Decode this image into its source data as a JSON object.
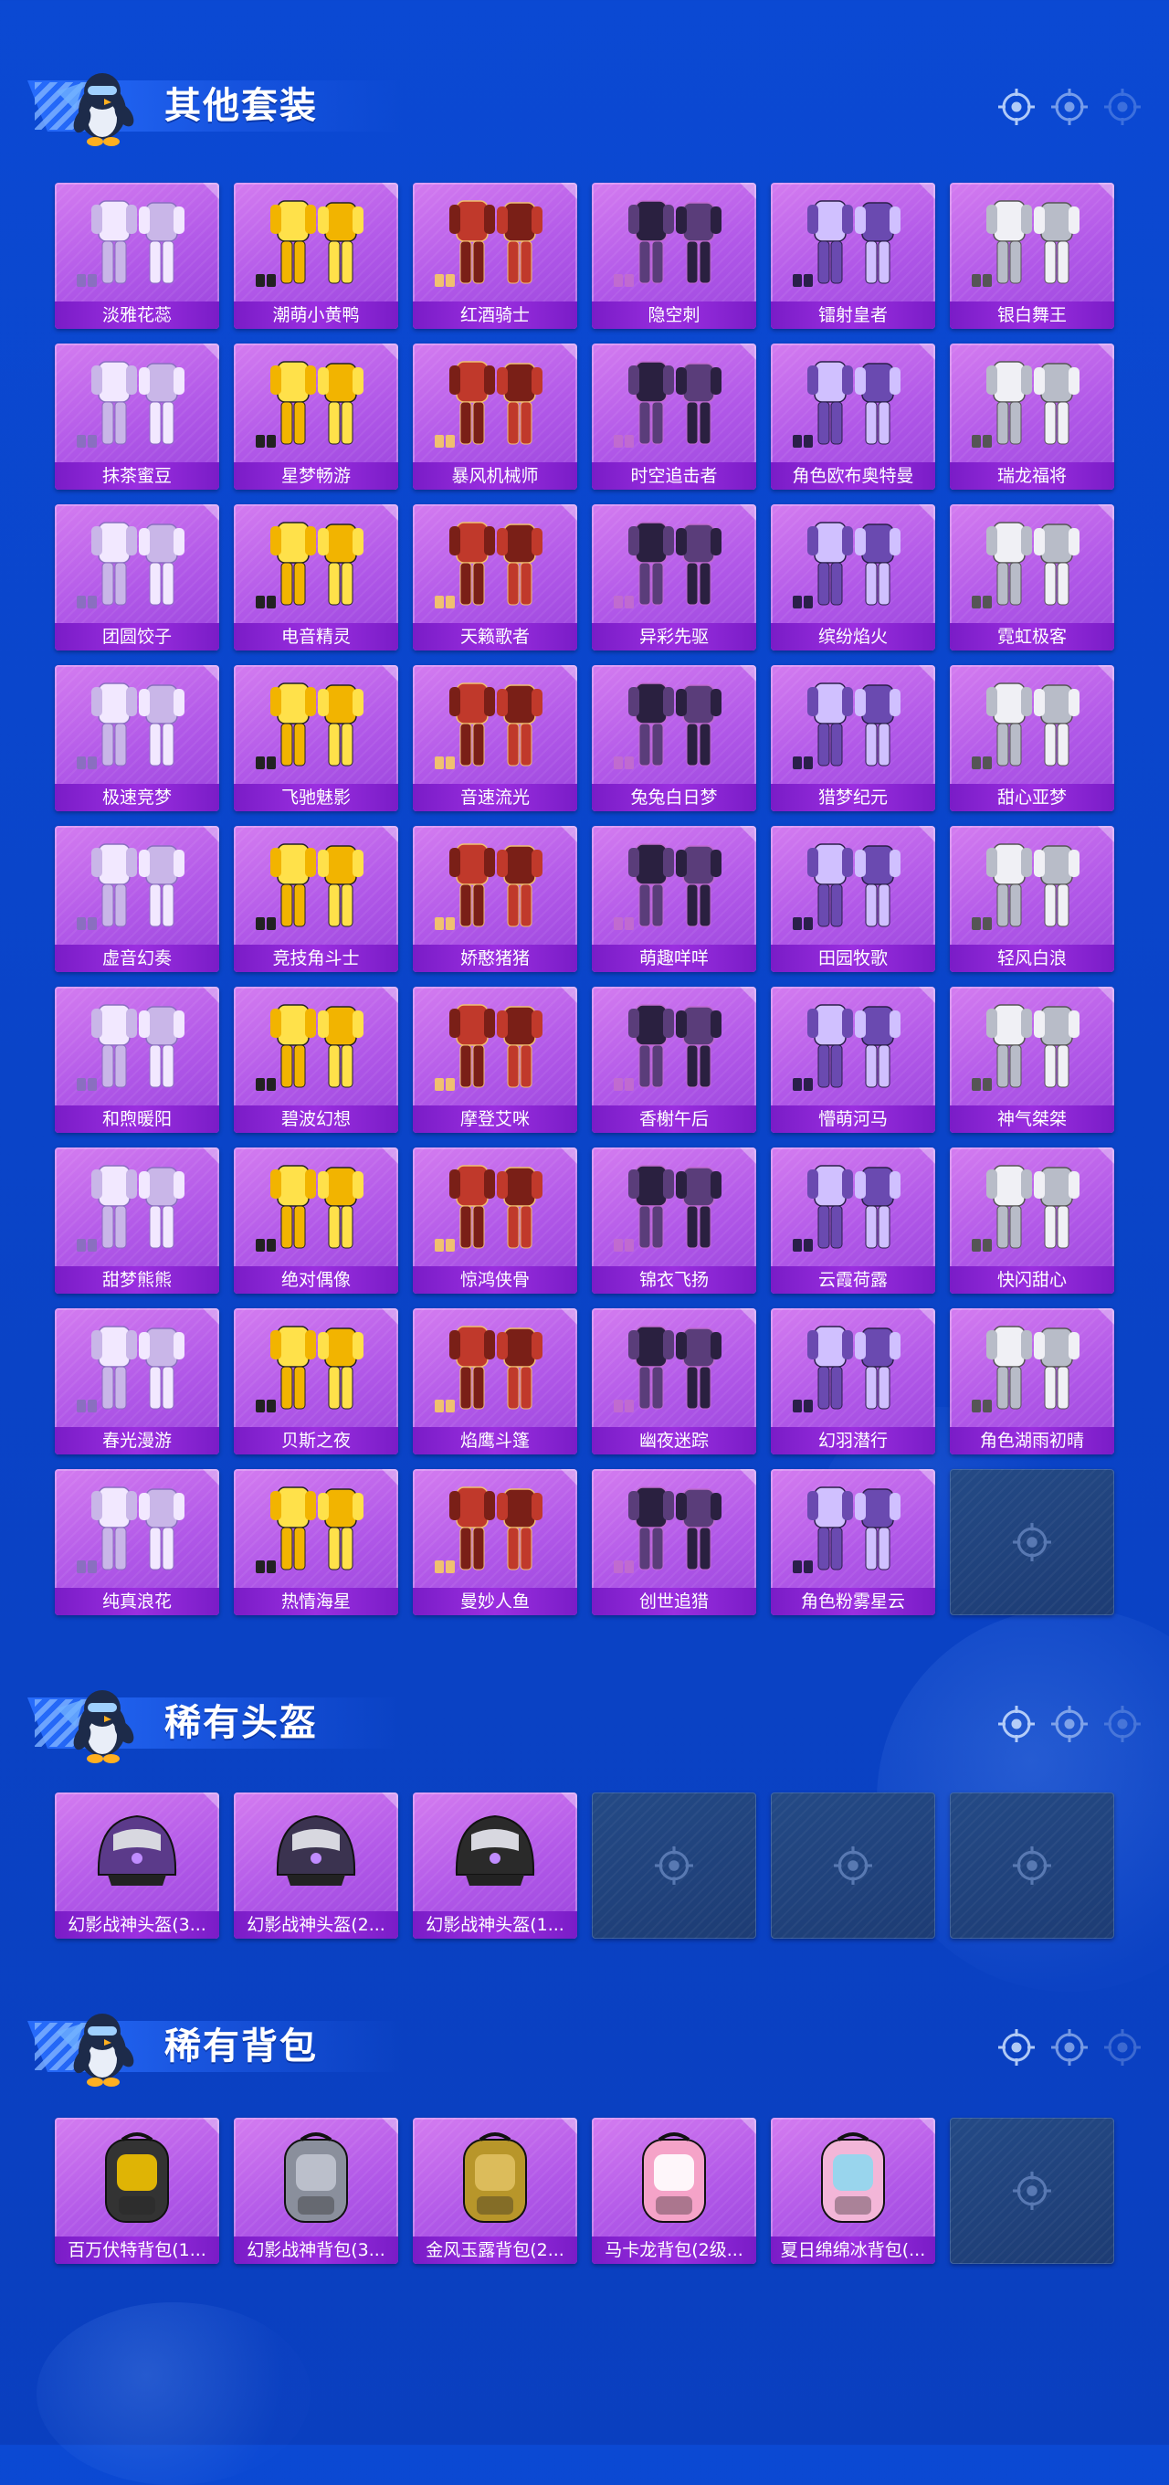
{
  "colors": {
    "background": "#0b49d3",
    "card": "#b158e8",
    "label_bar": "#8a25d8",
    "empty_card": "#1f3f7a"
  },
  "icons": {
    "section_mascot": "penguin-mascot-icon",
    "deco": "crosshair-icon",
    "empty_slot": "crosshair-icon"
  },
  "sections": [
    {
      "title": "其他套装",
      "items": [
        "淡雅花蕊",
        "潮萌小黄鸭",
        "红酒骑士",
        "隐空刺",
        "镭射皇者",
        "银白舞王",
        "抹茶蜜豆",
        "星梦畅游",
        "暴风机械师",
        "时空追击者",
        "角色欧布奥特曼",
        "瑞龙福将",
        "团圆饺子",
        "电音精灵",
        "天籁歌者",
        "异彩先驱",
        "缤纷焰火",
        "霓虹极客",
        "极速竞梦",
        "飞驰魅影",
        "音速流光",
        "兔兔白日梦",
        "猎梦纪元",
        "甜心亚梦",
        "虚音幻奏",
        "竞技角斗士",
        "娇憨猪猪",
        "萌趣咩咩",
        "田园牧歌",
        "轻风白浪",
        "和煦暖阳",
        "碧波幻想",
        "摩登艾咪",
        "香榭午后",
        "懵萌河马",
        "神气桀桀",
        "甜梦熊熊",
        "绝对偶像",
        "惊鸿侠骨",
        "锦衣飞扬",
        "云霞荷露",
        "快闪甜心",
        "春光漫游",
        "贝斯之夜",
        "焰鹰斗篷",
        "幽夜迷踪",
        "幻羽潜行",
        "角色湖雨初晴",
        "纯真浪花",
        "热情海星",
        "曼妙人鱼",
        "创世追猎",
        "角色粉雾星云"
      ],
      "empty_slots": 1
    },
    {
      "title": "稀有头盔",
      "items": [
        "幻影战神头盔(3...",
        "幻影战神头盔(2...",
        "幻影战神头盔(1..."
      ],
      "empty_slots": 3
    },
    {
      "title": "稀有背包",
      "items": [
        "百万伏特背包(1...",
        "幻影战神背包(3...",
        "金风玉露背包(2...",
        "马卡龙背包(2级...",
        "夏日绵绵冰背包(..."
      ],
      "empty_slots": 1
    }
  ]
}
